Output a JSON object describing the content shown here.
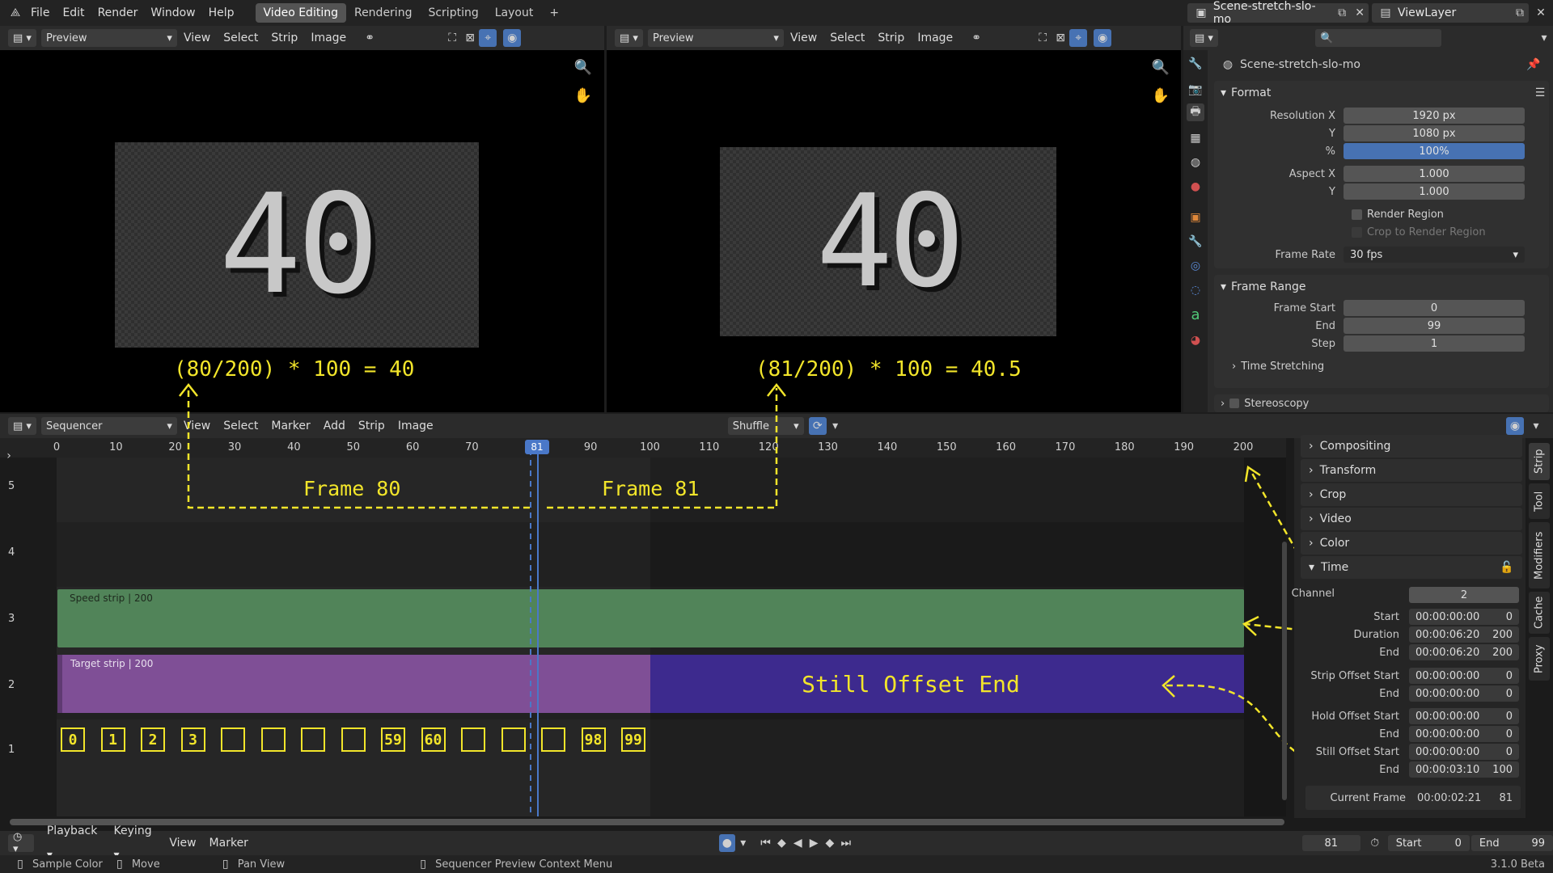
{
  "topbar": {
    "menus": [
      "File",
      "Edit",
      "Render",
      "Window",
      "Help"
    ],
    "workspaces": [
      "Video Editing",
      "Rendering",
      "Scripting",
      "Layout"
    ],
    "add_tab": "+",
    "scene_name": "Scene-stretch-slo-mo",
    "view_layer": "ViewLayer"
  },
  "preview_left": {
    "mode": "Preview",
    "menus": [
      "View",
      "Select",
      "Strip",
      "Image"
    ],
    "number": "40",
    "formula": "(80/200) * 100 = 40"
  },
  "preview_right": {
    "mode": "Preview",
    "menus": [
      "View",
      "Select",
      "Strip",
      "Image"
    ],
    "number": "40",
    "formula": "(81/200) * 100 = 40.5"
  },
  "properties": {
    "scene_name": "Scene-stretch-slo-mo",
    "format_title": "Format",
    "resolution_x_label": "Resolution X",
    "resolution_x": "1920 px",
    "y_label": "Y",
    "resolution_y": "1080 px",
    "percent_label": "%",
    "percent": "100%",
    "aspect_x_label": "Aspect X",
    "aspect_x": "1.000",
    "aspect_y_label": "Y",
    "aspect_y": "1.000",
    "render_region": "Render Region",
    "crop_region": "Crop to Render Region",
    "frame_rate_label": "Frame Rate",
    "frame_rate": "30 fps",
    "frame_range_title": "Frame Range",
    "frame_start_label": "Frame Start",
    "frame_start": "0",
    "end_label": "End",
    "frame_end": "99",
    "step_label": "Step",
    "frame_step": "1",
    "time_stretching": "Time Stretching",
    "stereoscopy": "Stereoscopy"
  },
  "sequencer": {
    "mode": "Sequencer",
    "menus": [
      "View",
      "Select",
      "Marker",
      "Add",
      "Strip",
      "Image"
    ],
    "overlap_mode": "Shuffle",
    "ticks": [
      "0",
      "10",
      "20",
      "30",
      "40",
      "50",
      "60",
      "70",
      "80",
      "90",
      "100",
      "110",
      "120",
      "130",
      "140",
      "150",
      "160",
      "170",
      "180",
      "190",
      "200"
    ],
    "playhead": "81",
    "channels": [
      "5",
      "4",
      "3",
      "2",
      "1"
    ],
    "speed_strip": "Speed strip | 200",
    "target_strip": "Target strip | 200",
    "frame80": "Frame 80",
    "frame81": "Frame 81",
    "still_offset": "Still Offset End",
    "frame_boxes": [
      "0",
      "1",
      "2",
      "3",
      "",
      "",
      "",
      "",
      "59",
      "60",
      "",
      "",
      "",
      "98",
      "99"
    ]
  },
  "strip_sidebar": {
    "panels": [
      "Compositing",
      "Transform",
      "Crop",
      "Video",
      "Color"
    ],
    "time_title": "Time",
    "channel_label": "Channel",
    "channel": "2",
    "rows": [
      {
        "label": "Start",
        "tc": "00:00:00:00",
        "val": "0"
      },
      {
        "label": "Duration",
        "tc": "00:00:06:20",
        "val": "200"
      },
      {
        "label": "End",
        "tc": "00:00:06:20",
        "val": "200"
      },
      {
        "label": "Strip Offset Start",
        "tc": "00:00:00:00",
        "val": "0"
      },
      {
        "label": "End",
        "tc": "00:00:00:00",
        "val": "0"
      },
      {
        "label": "Hold Offset Start",
        "tc": "00:00:00:00",
        "val": "0"
      },
      {
        "label": "End",
        "tc": "00:00:00:00",
        "val": "0"
      },
      {
        "label": "Still Offset Start",
        "tc": "00:00:00:00",
        "val": "0"
      },
      {
        "label": "End",
        "tc": "00:00:03:10",
        "val": "100"
      }
    ],
    "current_frame_label": "Current Frame",
    "current_tc": "00:00:02:21",
    "current_val": "81",
    "vtabs": [
      "Strip",
      "Tool",
      "Modifiers",
      "Cache",
      "Proxy"
    ]
  },
  "timeline": {
    "menus": [
      "Playback",
      "Keying",
      "View",
      "Marker"
    ],
    "current": "81",
    "start_label": "Start",
    "start": "0",
    "end_label": "End",
    "end": "99"
  },
  "statusbar": {
    "sample": "Sample Color",
    "move": "Move",
    "pan": "Pan View",
    "context": "Sequencer Preview Context Menu",
    "version": "3.1.0 Beta"
  }
}
